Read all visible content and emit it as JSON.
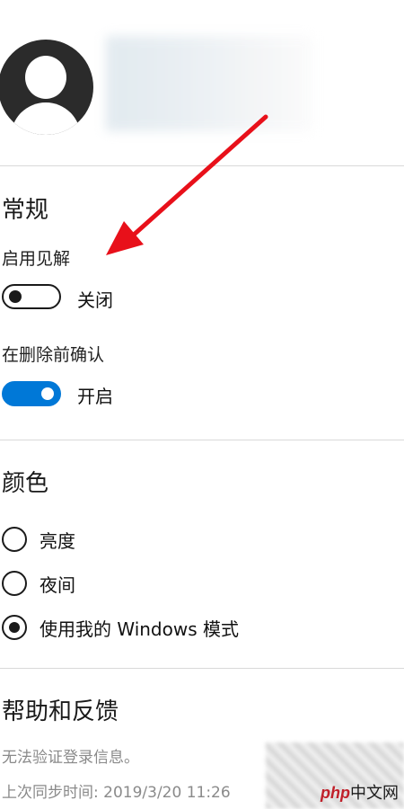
{
  "account": {
    "avatar": "person-avatar",
    "name_redacted": true
  },
  "general": {
    "title": "常规",
    "insights": {
      "label": "启用见解",
      "state_label": "关闭",
      "on": false
    },
    "confirm_delete": {
      "label": "在删除前确认",
      "state_label": "开启",
      "on": true
    }
  },
  "color": {
    "title": "颜色",
    "options": [
      {
        "label": "亮度",
        "selected": false
      },
      {
        "label": "夜间",
        "selected": false
      },
      {
        "label": "使用我的 Windows 模式",
        "selected": true
      }
    ]
  },
  "help": {
    "title": "帮助和反馈",
    "status": "无法验证登录信息。",
    "last_sync": "上次同步时间: 2019/3/20 11:26"
  },
  "watermark": {
    "brand": "php",
    "suffix": "中文网"
  },
  "colors": {
    "accent": "#0078d7",
    "arrow": "#e8101a",
    "divider": "#d9d9d9"
  }
}
